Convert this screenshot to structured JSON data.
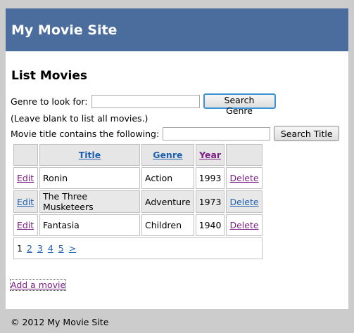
{
  "header": {
    "site_title": "My Movie Site"
  },
  "main": {
    "page_title": "List Movies",
    "genre_search": {
      "label": "Genre to look for:",
      "value": "",
      "button": "Search Genre",
      "hint": "(Leave blank to list all movies.)"
    },
    "title_search": {
      "label": "Movie title contains the following:",
      "value": "",
      "button": "Search Title"
    },
    "table": {
      "headers": {
        "title": "Title",
        "genre": "Genre",
        "year": "Year"
      },
      "rows": [
        {
          "edit": "Edit",
          "title": "Ronin",
          "genre": "Action",
          "year": "1993",
          "delete": "Delete"
        },
        {
          "edit": "Edit",
          "title": "The Three Musketeers",
          "genre": "Adventure",
          "year": "1973",
          "delete": "Delete"
        },
        {
          "edit": "Edit",
          "title": "Fantasia",
          "genre": "Children",
          "year": "1940",
          "delete": "Delete"
        }
      ],
      "pager": {
        "current": "1",
        "pages": [
          "2",
          "3",
          "4",
          "5"
        ],
        "next": ">"
      }
    },
    "add_link": "Add a movie"
  },
  "footer": {
    "copyright": "© 2012 My Movie Site"
  },
  "colors": {
    "header_bg": "#4a6d9e",
    "link": "#2060b0",
    "visited_link": "#7b1f86",
    "page_bg": "#cccccc"
  }
}
